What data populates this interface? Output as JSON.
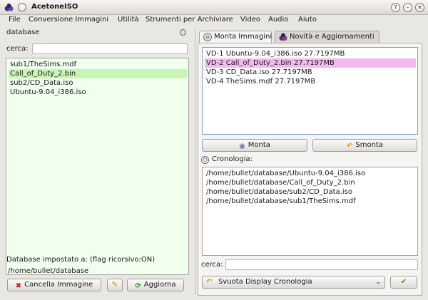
{
  "window": {
    "title": "AcetoneISO"
  },
  "menu": [
    "File",
    "Conversione Immagini",
    "Utilità",
    "Strumenti per Archiviare",
    "Video",
    "Audio",
    "Aiuto"
  ],
  "left": {
    "section_label": "database",
    "search_label": "cerca:",
    "search_value": "",
    "files": [
      "sub1/TheSims.mdf",
      "Call_of_Duty_2.bin",
      "sub2/CD_Data.iso",
      "Ubuntu-9.04_i386.iso"
    ],
    "db_label": "Database impostato a:  (flag ricorsivo:ON)",
    "db_path": "/home/bullet/database",
    "delete_button": "Cancella Immagine",
    "refresh_button": "Aggiorna"
  },
  "right": {
    "tabs": [
      "Monta Immagini",
      "Novità e Aggiornamenti"
    ],
    "mounted": [
      "VD-1 Ubuntu-9.04_i386.iso  27.7197MB",
      "VD-2 Call_of_Duty_2.bin  27.7197MB",
      "VD-3 CD_Data.iso  27.7197MB",
      "VD-4 TheSims.mdf  27.7197MB"
    ],
    "mount_button": "Monta",
    "unmount_button": "Smonta",
    "history_label": "Cronologia:",
    "history": [
      "/home/bullet/database/Ubuntu-9.04_i386.iso",
      "/home/bullet/database/Call_of_Duty_2.bin",
      "/home/bullet/database/sub2/CD_Data.iso",
      "/home/bullet/database/sub1/TheSims.mdf"
    ],
    "search_label": "cerca:",
    "search_value": "",
    "combo_value": "Svuota Display Cronologia"
  },
  "colors": {
    "selected_green": "#c8f5b4",
    "selected_pink": "#f4b8f0",
    "accent_blue": "#7f9fd6"
  }
}
